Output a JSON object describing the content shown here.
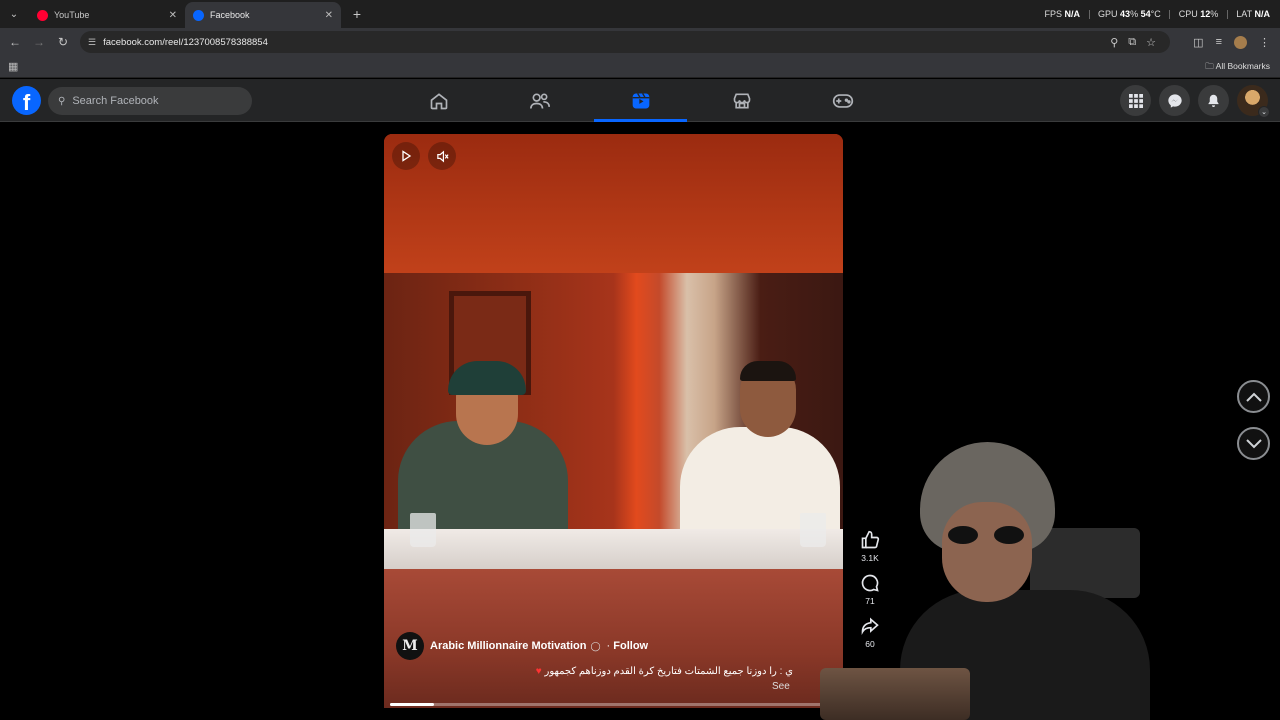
{
  "browser": {
    "tabs": [
      {
        "title": "YouTube",
        "active": false,
        "favicon_color": "#ff0033"
      },
      {
        "title": "Facebook",
        "active": true,
        "favicon_color": "#0866ff"
      }
    ],
    "url": "facebook.com/reel/1237008578388854",
    "bookmarks_label": "All Bookmarks",
    "stats": {
      "fps_label": "FPS",
      "fps_value": "N/A",
      "gpu_label": "GPU",
      "gpu_value": "43",
      "gpu_temp": "54",
      "cpu_label": "CPU",
      "cpu_value": "12",
      "lat_label": "LAT",
      "lat_value": "N/A"
    }
  },
  "facebook": {
    "search_placeholder": "Search Facebook",
    "nav_active": "reels",
    "nav_items": [
      "home",
      "friends",
      "reels",
      "marketplace",
      "gaming"
    ]
  },
  "reel": {
    "author": "Arabic Millionnaire Motivation",
    "follow_label": "Follow",
    "separator": "·",
    "caption": "ي : را دوزنا جميع الشمتات فتاريخ كرة القدم دوزناهم كجمهور",
    "see_more": "See",
    "progress": 0.1,
    "likes": "3.1K",
    "comments": "71",
    "shares": "60",
    "logo_letter": "M"
  },
  "colors": {
    "fb_blue": "#0866ff",
    "fb_bar": "#242526",
    "chrome_dark": "#1f1f1f"
  }
}
